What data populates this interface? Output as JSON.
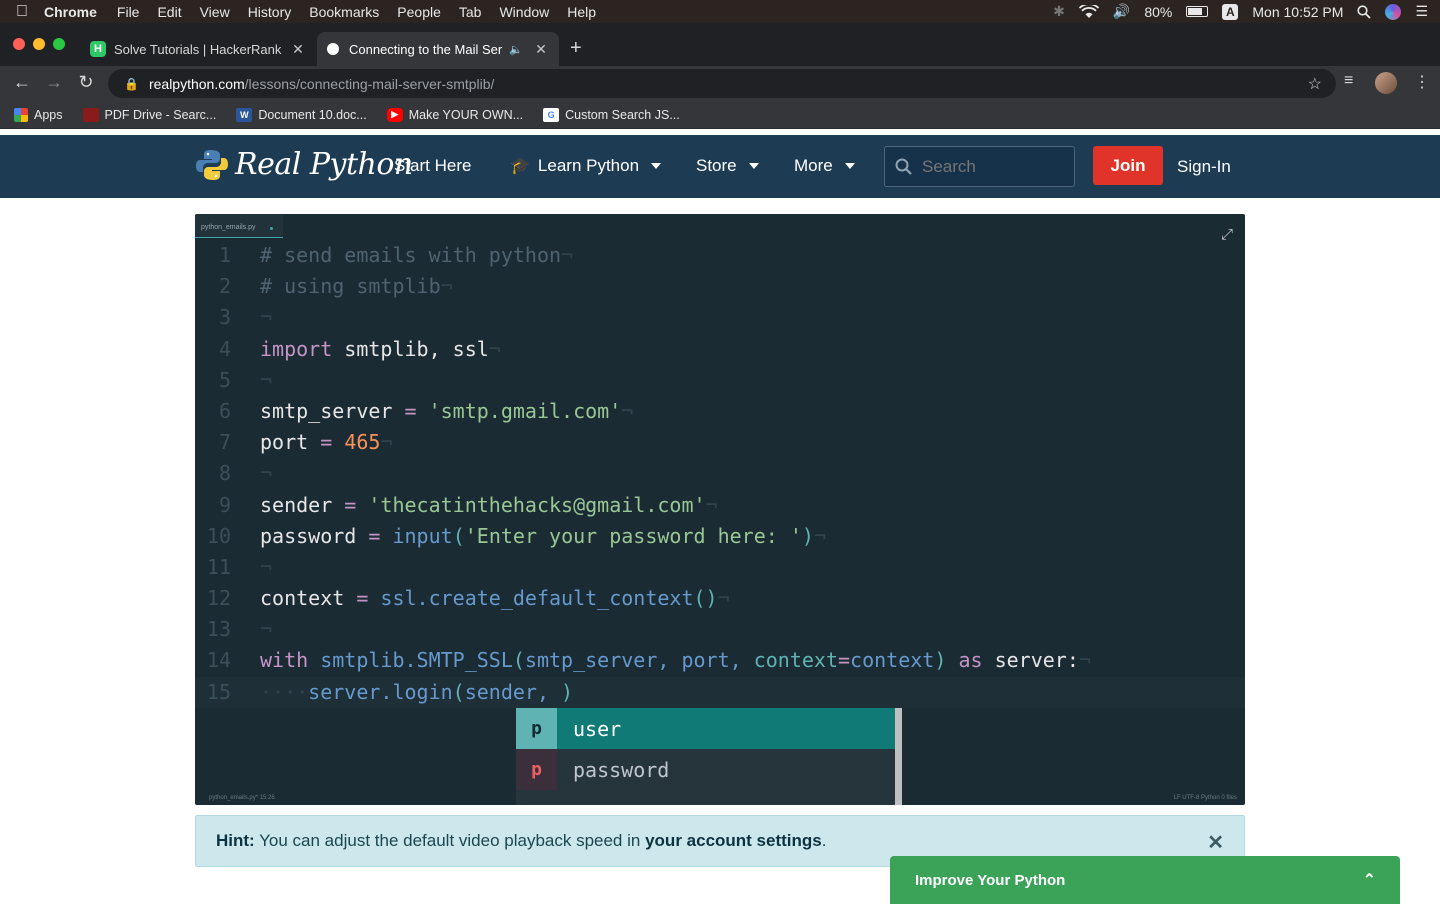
{
  "menubar": {
    "app": "Chrome",
    "items": [
      "File",
      "Edit",
      "View",
      "History",
      "Bookmarks",
      "People",
      "Tab",
      "Window",
      "Help"
    ],
    "battery": "80%",
    "input_source": "A",
    "clock": "Mon 10:52 PM"
  },
  "tabs": [
    {
      "title": "Solve Tutorials | HackerRank",
      "favicon": "H",
      "active": false
    },
    {
      "title": "Connecting to the Mail Ser",
      "active": true
    }
  ],
  "address": {
    "host": "realpython.com",
    "path": "/lessons/connecting-mail-server-smtplib/"
  },
  "bookmarks": [
    {
      "label": "Apps"
    },
    {
      "label": "PDF Drive - Searc..."
    },
    {
      "label": "Document 10.doc..."
    },
    {
      "label": "Make YOUR OWN..."
    },
    {
      "label": "Custom Search JS..."
    }
  ],
  "site": {
    "logo": "Real Python",
    "nav": {
      "start": "Start Here",
      "learn": "Learn Python",
      "store": "Store",
      "more": "More"
    },
    "search_placeholder": "Search",
    "join": "Join",
    "signin": "Sign-In"
  },
  "editor": {
    "filename": "python_emails.py",
    "lines": [
      "1",
      "2",
      "3",
      "4",
      "5",
      "6",
      "7",
      "8",
      "9",
      "10",
      "11",
      "12",
      "13",
      "14",
      "15"
    ],
    "autocomplete": [
      {
        "kind": "p",
        "label": "user"
      },
      {
        "kind": "p",
        "label": "password"
      }
    ],
    "status_left": "python_emails.py*  15:26",
    "status_right": "LF  UTF-8  Python  0 files"
  },
  "hint": {
    "prefix": "Hint:",
    "text": "You can adjust the default video playback speed in",
    "link": "your account settings",
    "suffix": "."
  },
  "improve": {
    "label": "Improve Your Python"
  }
}
